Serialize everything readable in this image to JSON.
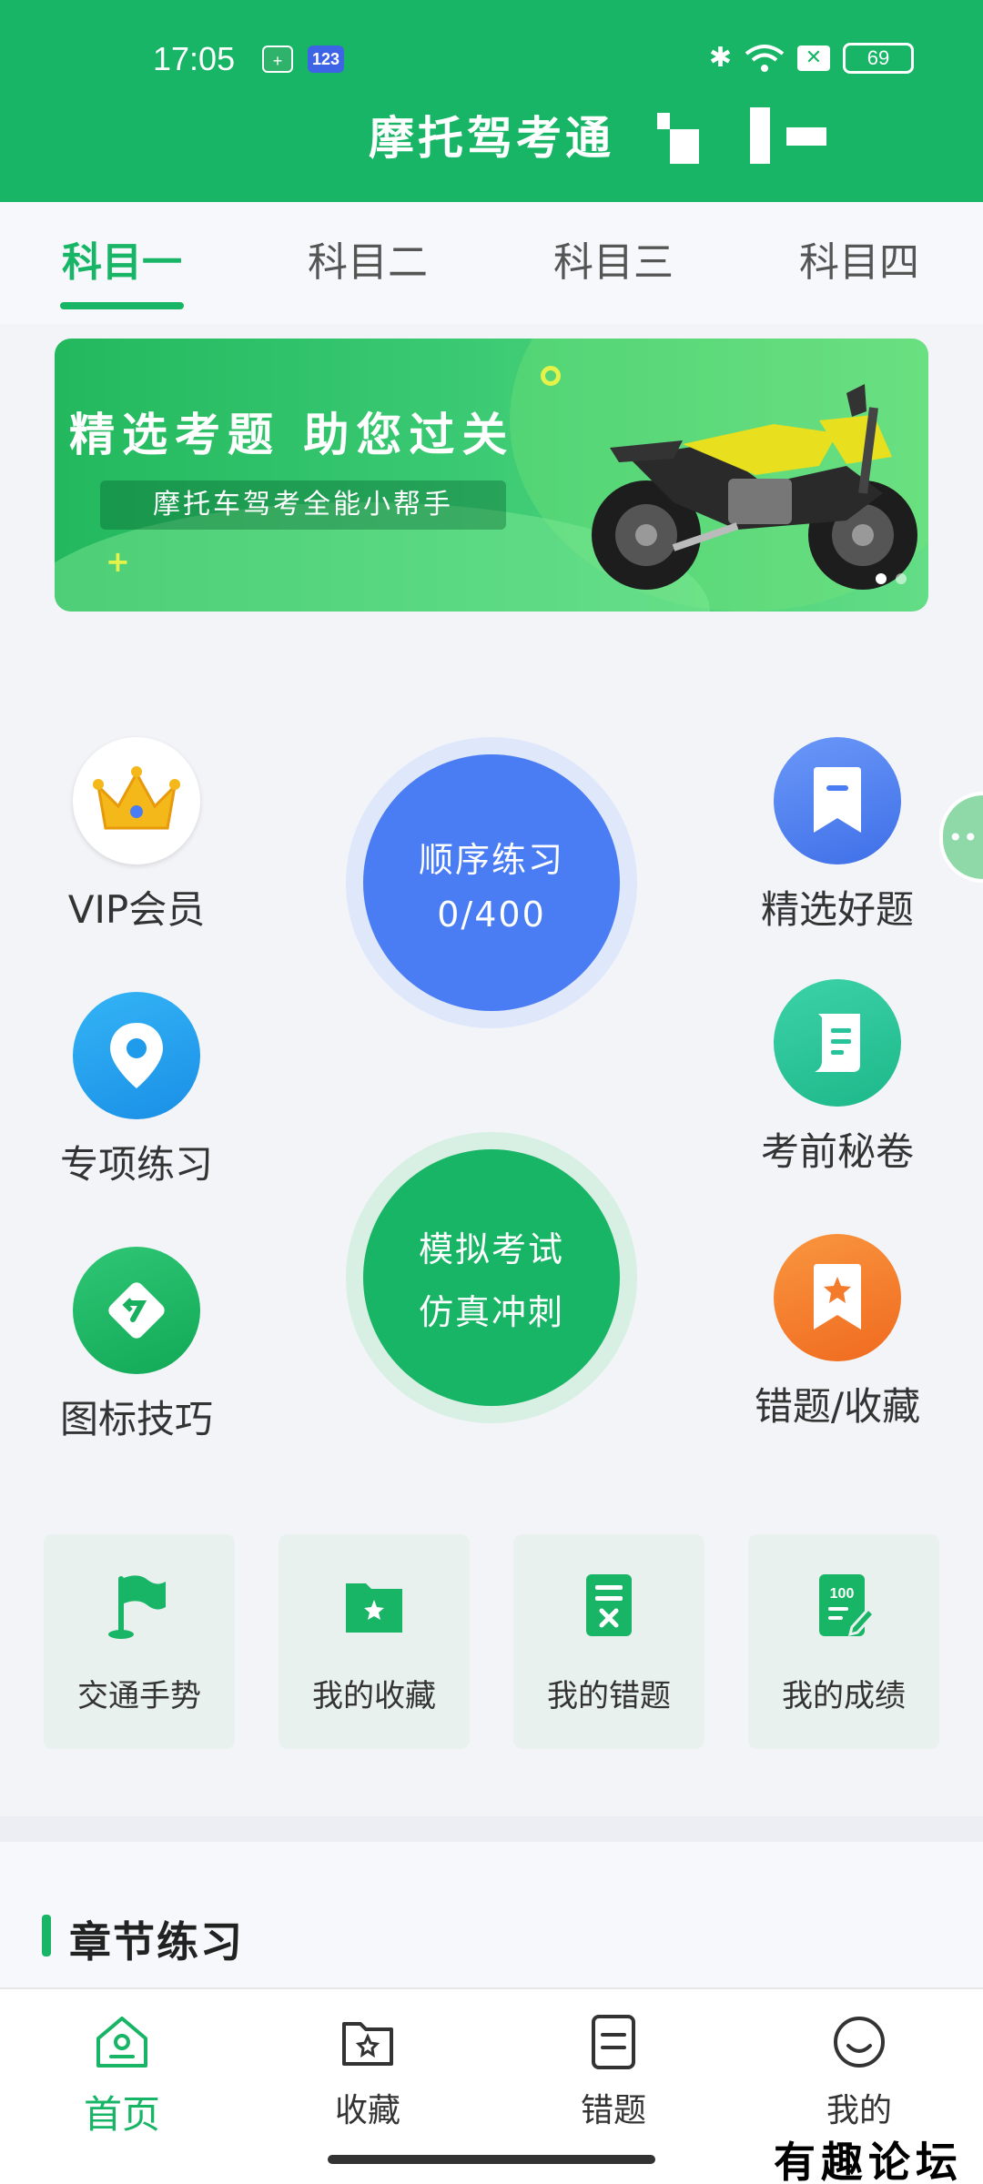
{
  "status_bar": {
    "time": "17:05",
    "shield_badge": "+",
    "num_badge": "123",
    "battery": "69"
  },
  "header": {
    "title": "摩托驾考通"
  },
  "tabs": [
    {
      "label": "科目一",
      "active": true
    },
    {
      "label": "科目二",
      "active": false
    },
    {
      "label": "科目三",
      "active": false
    },
    {
      "label": "科目四",
      "active": false
    }
  ],
  "banner": {
    "title": "精选考题  助您过关",
    "subtitle": "摩托车驾考全能小帮手"
  },
  "features": {
    "vip": {
      "label": "VIP会员",
      "icon": "crown-icon"
    },
    "special": {
      "label": "专项练习",
      "icon": "location-pin-icon"
    },
    "sign_tips": {
      "label": "图标技巧",
      "icon": "road-sign-icon"
    },
    "selected": {
      "label": "精选好题",
      "icon": "bookmark-icon"
    },
    "secret": {
      "label": "考前秘卷",
      "icon": "scroll-icon"
    },
    "wrong_fav": {
      "label": "错题/收藏",
      "icon": "star-bookmark-icon"
    },
    "sequence": {
      "line1": "顺序练习",
      "line2": "0/400",
      "progress_done": 0,
      "progress_total": 400
    },
    "mock_exam": {
      "line1": "模拟考试",
      "line2": "仿真冲刺"
    }
  },
  "cards": [
    {
      "label": "交通手势",
      "icon": "flag-icon"
    },
    {
      "label": "我的收藏",
      "icon": "star-folder-icon"
    },
    {
      "label": "我的错题",
      "icon": "wrong-doc-icon"
    },
    {
      "label": "我的成绩",
      "icon": "score-doc-icon"
    }
  ],
  "section": {
    "title": "章节练习"
  },
  "bottom_nav": [
    {
      "label": "首页",
      "icon": "home-icon",
      "active": true
    },
    {
      "label": "收藏",
      "icon": "star-folder-icon",
      "active": false
    },
    {
      "label": "错题",
      "icon": "list-doc-icon",
      "active": false
    },
    {
      "label": "我的",
      "icon": "smile-icon",
      "active": false
    }
  ],
  "watermark": "有趣论坛",
  "colors": {
    "brand_green": "#17b565",
    "blue": "#4a7cf3",
    "teal": "#27c39a",
    "orange": "#f47a2c"
  }
}
